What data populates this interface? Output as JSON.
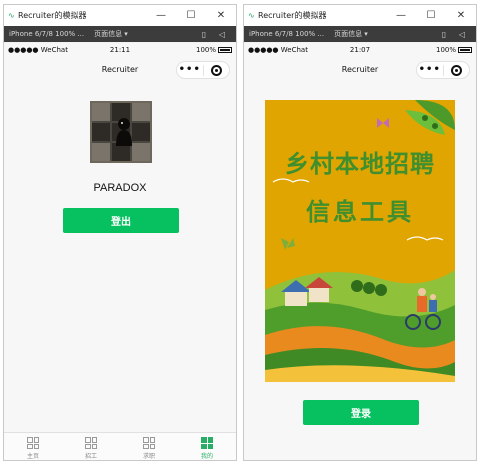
{
  "window_left": {
    "title": "Recruiter的模拟器",
    "device": "iPhone 6/7/8 100% ...",
    "page_info": "页面信息 ▾",
    "status": {
      "carrier": "●●●●● WeChat",
      "time": "21:11",
      "battery": "100%"
    },
    "nav_title": "Recruiter",
    "username": "PARADOX",
    "logout_label": "登出",
    "tabs": [
      {
        "label": "主页",
        "active": false
      },
      {
        "label": "招工",
        "active": false
      },
      {
        "label": "求职",
        "active": false
      },
      {
        "label": "我的",
        "active": true
      }
    ]
  },
  "window_right": {
    "title": "Recruiter的模拟器",
    "device": "iPhone 6/7/8 100% ...",
    "page_info": "页面信息 ▾",
    "status": {
      "carrier": "●●●●● WeChat",
      "time": "21:07",
      "battery": "100%"
    },
    "nav_title": "Recruiter",
    "poster_line1": "乡村本地招聘",
    "poster_line2": "信息工具",
    "login_label": "登录"
  },
  "controls": {
    "minimize": "—",
    "maximize": "☐",
    "close": "✕"
  },
  "colors": {
    "accent_green": "#07c160",
    "tab_active": "#2aae67",
    "poster_bg": "#e0a500",
    "poster_text": "#3f8f2f"
  }
}
